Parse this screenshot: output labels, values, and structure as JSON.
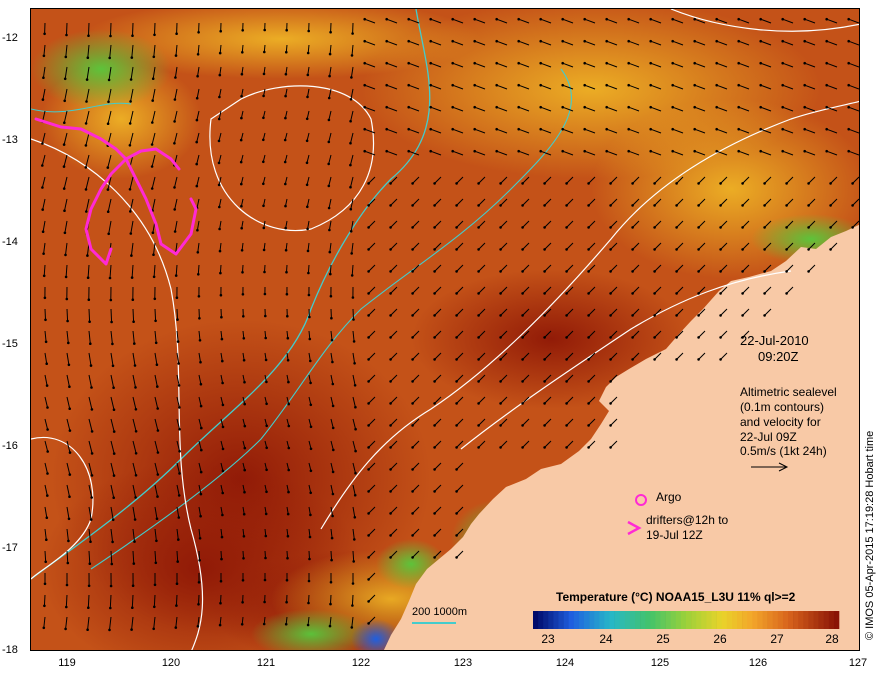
{
  "map": {
    "date": "22-Jul-2010",
    "time": "09:20Z",
    "altimetry_note": [
      "Altimetric sealevel",
      "(0.1m contours)",
      "and velocity for",
      "22-Jul 09Z",
      "0.5m/s (1kt 24h)"
    ],
    "argo_label": "Argo",
    "drifter_label": [
      "drifters@12h to",
      "19-Jul 12Z"
    ],
    "credit": "© IMOS 05-Apr-2015 17:19:28 Hobart time",
    "colorbar_title": "Temperature (°C) NOAA15_L3U 11% ql>=2",
    "colorbar_ticks": [
      "23",
      "24",
      "25",
      "26",
      "27",
      "28"
    ],
    "depth_legend": "200  1000m",
    "lat_ticks": [
      "-12",
      "-13",
      "-14",
      "-15",
      "-16",
      "-17",
      "-18"
    ],
    "lon_ticks": [
      "119",
      "120",
      "121",
      "122",
      "123",
      "124",
      "125",
      "126",
      "127"
    ],
    "colors": {
      "land": "#f8c9a6",
      "warm_sst": "#9a1e0a",
      "mid_sst": "#c9561a",
      "cool_sst": "#e1a220",
      "green_sst": "#5ac43c",
      "blue_sst": "#1a55d8",
      "isobath": "#4ccccc",
      "drifter": "#ff2ad4",
      "contour": "#ffffff",
      "arrow": "#000000"
    }
  }
}
